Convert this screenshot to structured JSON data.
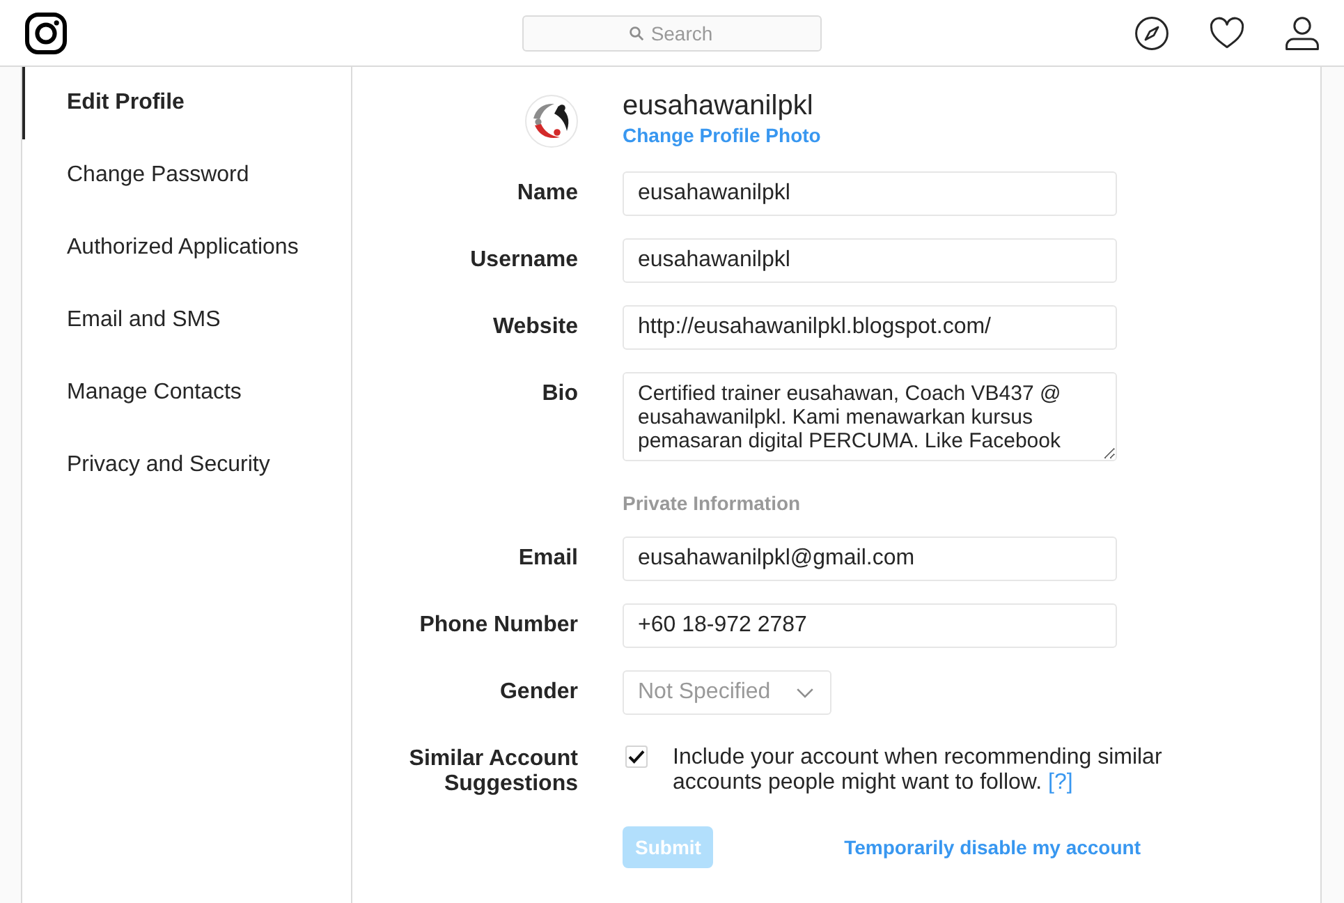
{
  "header": {
    "search": {
      "placeholder": "Search"
    }
  },
  "sidebar": {
    "items": [
      {
        "label": "Edit Profile",
        "selected": true
      },
      {
        "label": "Change Password",
        "selected": false
      },
      {
        "label": "Authorized Applications",
        "selected": false
      },
      {
        "label": "Email and SMS",
        "selected": false
      },
      {
        "label": "Manage Contacts",
        "selected": false
      },
      {
        "label": "Privacy and Security",
        "selected": false
      }
    ]
  },
  "profile": {
    "username": "eusahawanilpkl",
    "change_photo_link": "Change Profile Photo"
  },
  "fields": [
    {
      "kind": "input",
      "label": "Name",
      "value": "eusahawanilpkl"
    },
    {
      "kind": "input",
      "label": "Username",
      "value": "eusahawanilpkl"
    },
    {
      "kind": "input",
      "label": "Website",
      "value": "http://eusahawanilpkl.blogspot.com/"
    },
    {
      "kind": "textarea",
      "label": "Bio",
      "value": "Certified trainer eusahawan, Coach VB437 @ eusahawanilpkl. Kami menawarkan kursus pemasaran digital PERCUMA. Like Facebook"
    },
    {
      "kind": "section",
      "title": "Private Information"
    },
    {
      "kind": "input",
      "label": "Email",
      "value": "eusahawanilpkl@gmail.com"
    },
    {
      "kind": "input",
      "label": "Phone Number",
      "value": "+60 18-972 2787"
    },
    {
      "kind": "select",
      "label": "Gender",
      "placeholder": "Not Specified"
    },
    {
      "kind": "checkbox",
      "label": "Similar Account Suggestions",
      "checked": true,
      "text": "Include your account when recommending similar accounts people might want to follow.",
      "help_link": "[?]"
    }
  ],
  "actions": {
    "submit": {
      "label": "Submit",
      "disabled": true
    },
    "disable_link": "Temporarily disable my account"
  }
}
